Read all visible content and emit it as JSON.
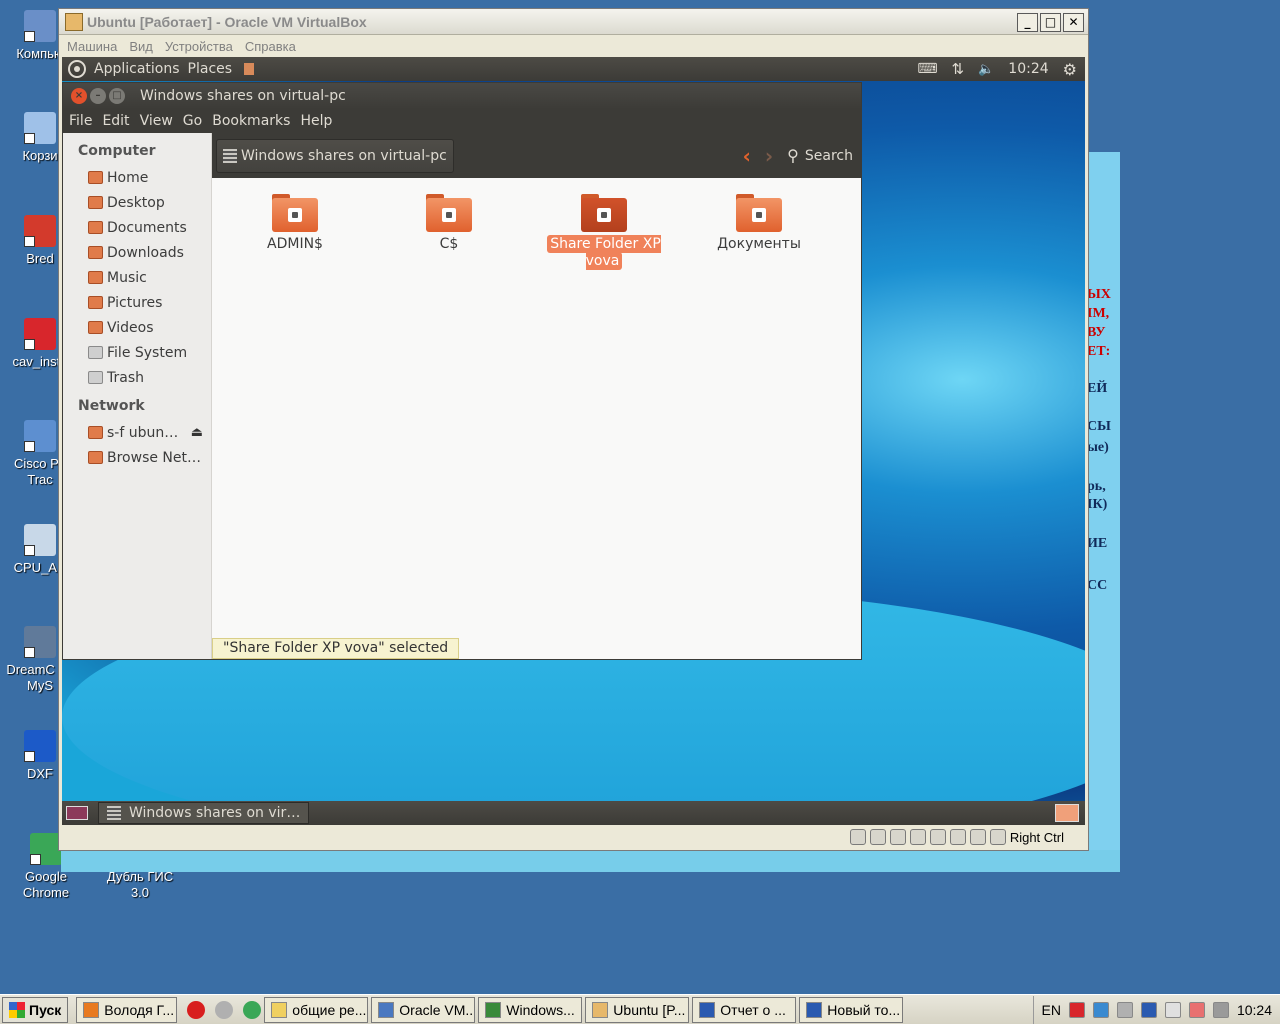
{
  "desktop": {
    "icons": [
      {
        "label": "Компью",
        "color": "#6a8fc8"
      },
      {
        "label": "Корзи",
        "color": "#9fc1e8"
      },
      {
        "label": "Bred",
        "color": "#d33a2c"
      },
      {
        "label": "cav_insta",
        "color": "#d8262c"
      },
      {
        "label": "Cisco Pa Trac",
        "color": "#5d8fd0"
      },
      {
        "label": "CPU_AN",
        "color": "#c8d8e8"
      },
      {
        "label": "DreamC for MyS",
        "color": "#607a9a"
      },
      {
        "label": "DXF",
        "color": "#1c5ac8"
      },
      {
        "label": "Google Chrome",
        "color": "#3aa757"
      },
      {
        "label": "Дубль ГИС 3.0",
        "color": "#f07820"
      }
    ],
    "bg_doc_red": [
      "ЫХ",
      "ІМ,",
      "ВУ",
      "ЕТ:"
    ],
    "bg_doc_blue": [
      "ЕЙ",
      "СЫ",
      "ые)",
      "рь,",
      "ІК)",
      "ИЕ",
      "СС"
    ]
  },
  "vbox": {
    "title": "Ubuntu [Работает] - Oracle VM VirtualBox",
    "menu": [
      "Машина",
      "Вид",
      "Устройства",
      "Справка"
    ],
    "host_key": "Right Ctrl"
  },
  "ubuntu_panel": {
    "applications": "Applications",
    "places": "Places",
    "time": "10:24",
    "keyboard_icon": "keyboard-icon",
    "network_icon": "network-arrows-icon",
    "volume_icon": "volume-icon",
    "gear_icon": "gear-icon"
  },
  "nautilus": {
    "title": "Windows shares on virtual-pc",
    "menu": [
      "File",
      "Edit",
      "View",
      "Go",
      "Bookmarks",
      "Help"
    ],
    "path": "Windows shares on virtual-pc",
    "search_label": "Search",
    "sidebar": {
      "computer_header": "Computer",
      "computer_items": [
        "Home",
        "Desktop",
        "Documents",
        "Downloads",
        "Music",
        "Pictures",
        "Videos",
        "File System",
        "Trash"
      ],
      "network_header": "Network",
      "network_items": [
        "s-f ubun…",
        "Browse Net…"
      ]
    },
    "files": [
      {
        "name": "ADMIN$",
        "selected": false
      },
      {
        "name": "C$",
        "selected": false
      },
      {
        "name": "Share Folder XP vova",
        "selected": true
      },
      {
        "name": "Документы",
        "selected": false
      }
    ],
    "status": "\"Share Folder XP vova\" selected"
  },
  "ubuntu_bottom": {
    "task": "Windows shares on vir…"
  },
  "taskbar": {
    "start": "Пуск",
    "buttons": [
      {
        "label": "Володя Г...",
        "color": "#e87a20"
      },
      {
        "label": "общие ре...",
        "color": "#f0d060"
      },
      {
        "label": "Oracle VM...",
        "color": "#4a78c0"
      },
      {
        "label": "Windows...",
        "color": "#3a8a3a"
      },
      {
        "label": "Ubuntu [P...",
        "color": "#e7b86a"
      },
      {
        "label": "Отчет о ...",
        "color": "#2a5ab0"
      },
      {
        "label": "Новый то...",
        "color": "#2a5ab0"
      }
    ],
    "lang": "EN",
    "time": "10:24"
  }
}
